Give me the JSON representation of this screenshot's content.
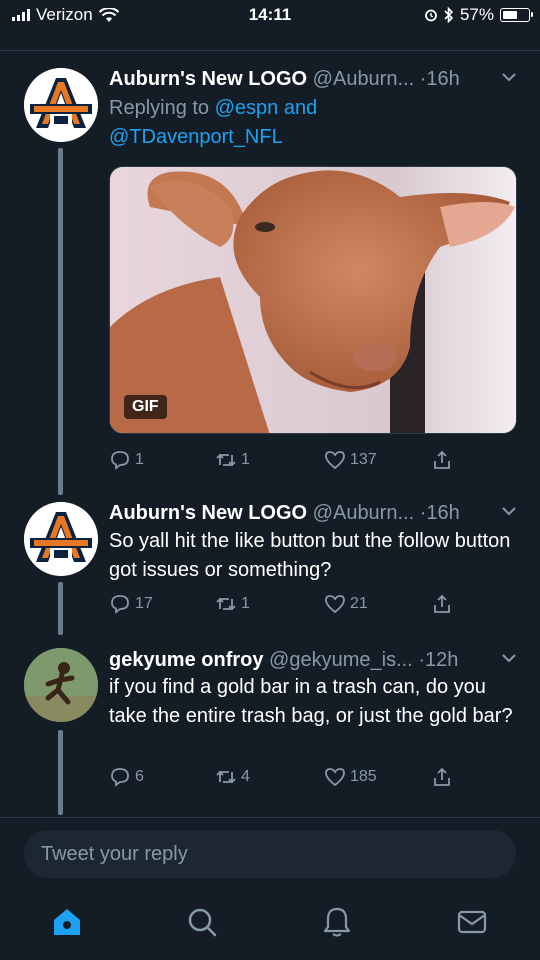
{
  "status_bar": {
    "carrier": "Verizon",
    "time": "14:11",
    "battery": "57%"
  },
  "tweets": [
    {
      "name": "Auburn's New LOGO",
      "handle": "@Auburn...",
      "time": "·16h",
      "replying_prefix": "Replying to",
      "replying_user1": "@espn",
      "replying_and": "and",
      "replying_user2": "@TDavenport_NFL",
      "media_badge": "GIF",
      "replies": "1",
      "retweets": "1",
      "likes": "137"
    },
    {
      "name": "Auburn's New LOGO",
      "handle": "@Auburn...",
      "time": "·16h",
      "text": "So yall hit the like button but the follow button got issues or something?",
      "replies": "17",
      "retweets": "1",
      "likes": "21"
    },
    {
      "name": "gekyume onfroy",
      "handle": "@gekyume_is...",
      "time": "·12h",
      "text": "if you find a gold bar in a trash can, do you take the entire trash bag, or just the gold bar?",
      "replies": "6",
      "retweets": "4",
      "likes": "185"
    }
  ],
  "reply_input": {
    "placeholder": "Tweet your reply"
  },
  "tabbar": {
    "items": [
      "home-icon",
      "search-icon",
      "notifications-icon",
      "messages-icon"
    ],
    "active": "home-icon"
  },
  "colors": {
    "background": "#141d26",
    "accent": "#1da1f2",
    "muted": "#8899a6",
    "auburn_blue": "#0c2340",
    "auburn_orange": "#e87722"
  }
}
